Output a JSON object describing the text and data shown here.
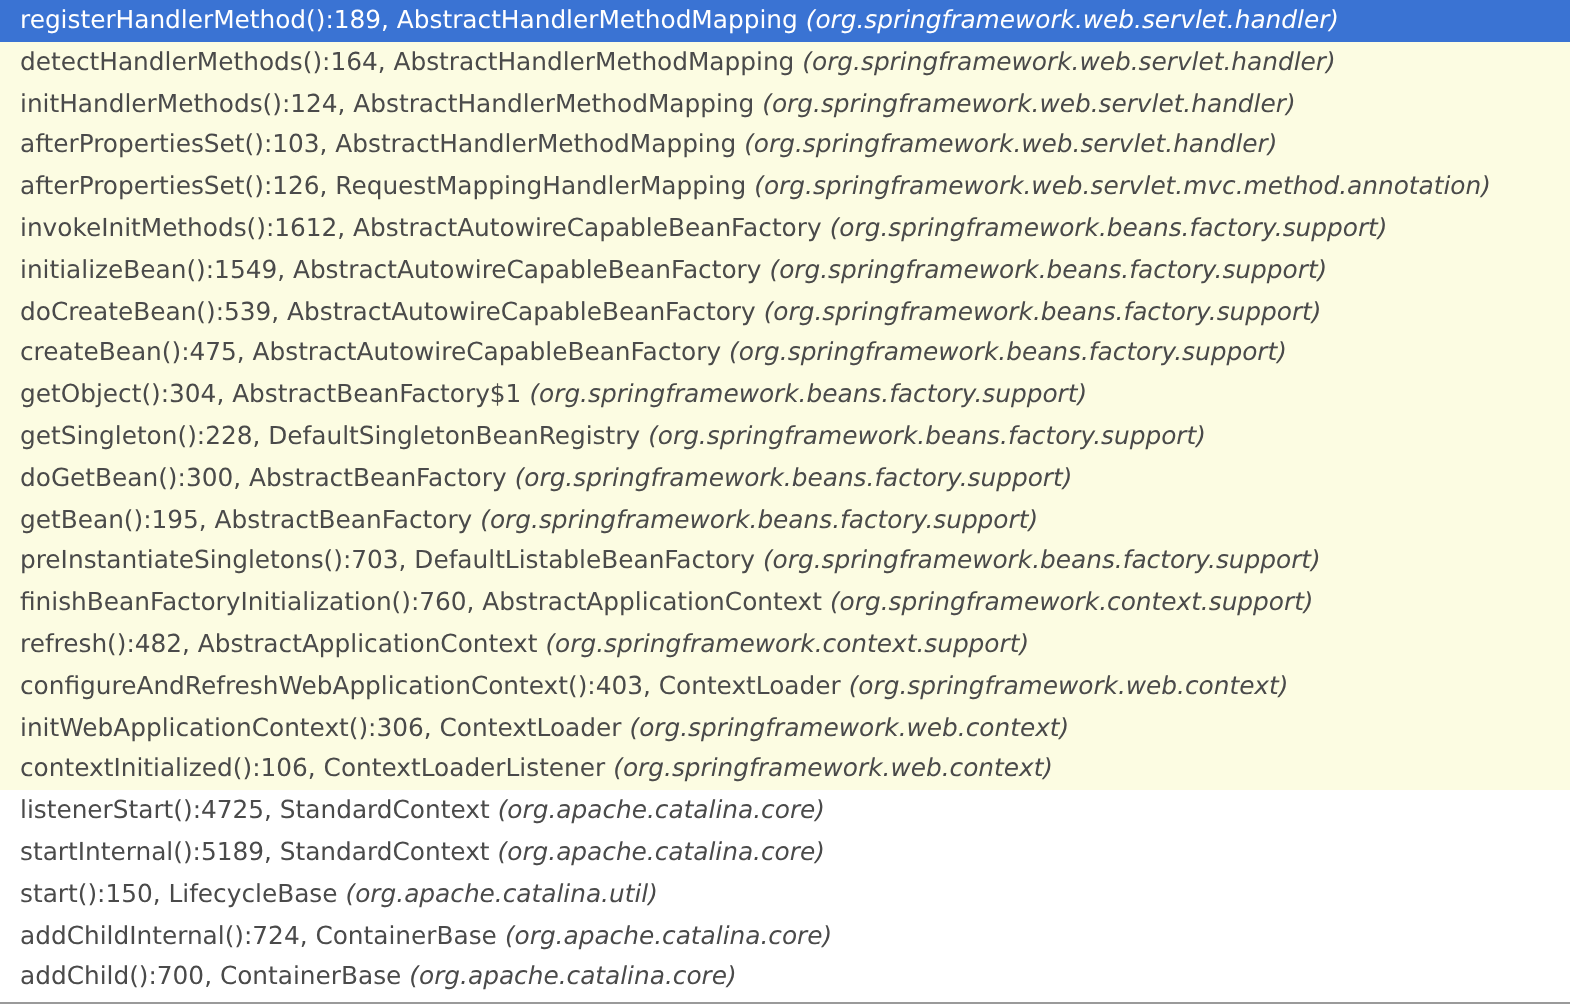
{
  "frames": [
    {
      "method": "registerHandlerMethod():189, AbstractHandlerMethodMapping",
      "package": "(org.springframework.web.servlet.handler)",
      "selected": true
    },
    {
      "method": "detectHandlerMethods():164, AbstractHandlerMethodMapping",
      "package": "(org.springframework.web.servlet.handler)",
      "selected": false,
      "highlighted": true
    },
    {
      "method": "initHandlerMethods():124, AbstractHandlerMethodMapping",
      "package": "(org.springframework.web.servlet.handler)",
      "selected": false,
      "highlighted": true
    },
    {
      "method": "afterPropertiesSet():103, AbstractHandlerMethodMapping",
      "package": "(org.springframework.web.servlet.handler)",
      "selected": false,
      "highlighted": true
    },
    {
      "method": "afterPropertiesSet():126, RequestMappingHandlerMapping",
      "package": "(org.springframework.web.servlet.mvc.method.annotation)",
      "selected": false,
      "highlighted": true
    },
    {
      "method": "invokeInitMethods():1612, AbstractAutowireCapableBeanFactory",
      "package": "(org.springframework.beans.factory.support)",
      "selected": false,
      "highlighted": true
    },
    {
      "method": "initializeBean():1549, AbstractAutowireCapableBeanFactory",
      "package": "(org.springframework.beans.factory.support)",
      "selected": false,
      "highlighted": true
    },
    {
      "method": "doCreateBean():539, AbstractAutowireCapableBeanFactory",
      "package": "(org.springframework.beans.factory.support)",
      "selected": false,
      "highlighted": true
    },
    {
      "method": "createBean():475, AbstractAutowireCapableBeanFactory",
      "package": "(org.springframework.beans.factory.support)",
      "selected": false,
      "highlighted": true
    },
    {
      "method": "getObject():304, AbstractBeanFactory$1",
      "package": "(org.springframework.beans.factory.support)",
      "selected": false,
      "highlighted": true
    },
    {
      "method": "getSingleton():228, DefaultSingletonBeanRegistry",
      "package": "(org.springframework.beans.factory.support)",
      "selected": false,
      "highlighted": true
    },
    {
      "method": "doGetBean():300, AbstractBeanFactory",
      "package": "(org.springframework.beans.factory.support)",
      "selected": false,
      "highlighted": true
    },
    {
      "method": "getBean():195, AbstractBeanFactory",
      "package": "(org.springframework.beans.factory.support)",
      "selected": false,
      "highlighted": true
    },
    {
      "method": "preInstantiateSingletons():703, DefaultListableBeanFactory",
      "package": "(org.springframework.beans.factory.support)",
      "selected": false,
      "highlighted": true
    },
    {
      "method": "finishBeanFactoryInitialization():760, AbstractApplicationContext",
      "package": "(org.springframework.context.support)",
      "selected": false,
      "highlighted": true
    },
    {
      "method": "refresh():482, AbstractApplicationContext",
      "package": "(org.springframework.context.support)",
      "selected": false,
      "highlighted": true
    },
    {
      "method": "configureAndRefreshWebApplicationContext():403, ContextLoader",
      "package": "(org.springframework.web.context)",
      "selected": false,
      "highlighted": true
    },
    {
      "method": "initWebApplicationContext():306, ContextLoader",
      "package": "(org.springframework.web.context)",
      "selected": false,
      "highlighted": true
    },
    {
      "method": "contextInitialized():106, ContextLoaderListener",
      "package": "(org.springframework.web.context)",
      "selected": false,
      "highlighted": true
    },
    {
      "method": "listenerStart():4725, StandardContext",
      "package": "(org.apache.catalina.core)",
      "selected": false,
      "highlighted": false
    },
    {
      "method": "startInternal():5189, StandardContext",
      "package": "(org.apache.catalina.core)",
      "selected": false,
      "highlighted": false
    },
    {
      "method": "start():150, LifecycleBase",
      "package": "(org.apache.catalina.util)",
      "selected": false,
      "highlighted": false
    },
    {
      "method": "addChildInternal():724, ContainerBase",
      "package": "(org.apache.catalina.core)",
      "selected": false,
      "highlighted": false
    },
    {
      "method": "addChild():700, ContainerBase",
      "package": "(org.apache.catalina.core)",
      "selected": false,
      "highlighted": false
    }
  ]
}
